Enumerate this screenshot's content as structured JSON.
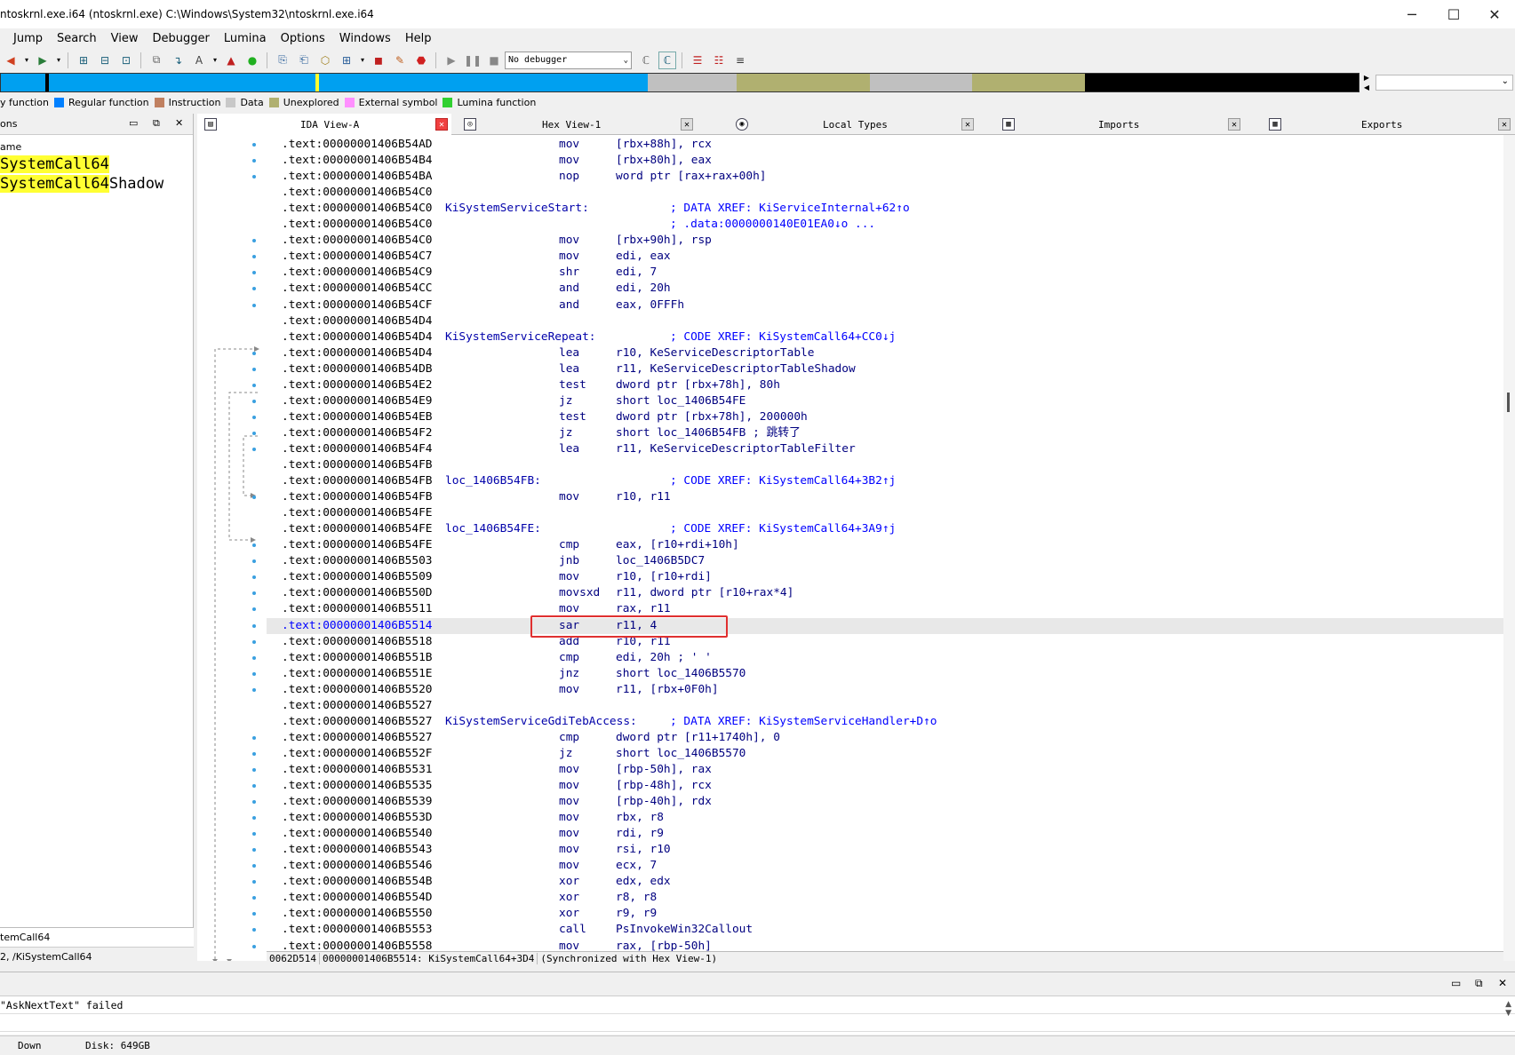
{
  "window": {
    "title": "ntoskrnl.exe.i64 (ntoskrnl.exe) C:\\Windows\\System32\\ntoskrnl.exe.i64",
    "minimize": "─",
    "maximize": "☐",
    "close": "✕"
  },
  "menu": [
    "Jump",
    "Search",
    "View",
    "Debugger",
    "Lumina",
    "Options",
    "Windows",
    "Help"
  ],
  "toolbar": {
    "debugger_select": "No debugger"
  },
  "navband_colors": {
    "regular_function": "#00a0f0",
    "instruction": "#c08060",
    "data": "#c0c0c0",
    "unexplored": "#b0b070",
    "external_symbol": "#ff90ff",
    "lumina_function": "#30d030",
    "library": "#000000"
  },
  "legend": [
    {
      "label": "y function",
      "color": ""
    },
    {
      "label": "Regular function",
      "color": "#0080ff"
    },
    {
      "label": "Instruction",
      "color": "#c08060"
    },
    {
      "label": "Data",
      "color": "#c8c8c8"
    },
    {
      "label": "Unexplored",
      "color": "#b0b070"
    },
    {
      "label": "External symbol",
      "color": "#ff90ff"
    },
    {
      "label": "Lumina function",
      "color": "#30d030"
    }
  ],
  "left_panel": {
    "header": "ons",
    "column_header": "ame",
    "functions": [
      {
        "hl": "SystemCall64",
        "rest": ""
      },
      {
        "hl": "SystemCall64",
        "rest": "Shadow"
      }
    ],
    "selected_footer": "temCall64",
    "path_footer": "2, /KiSystemCall64"
  },
  "tabs": [
    {
      "label": "IDA View-A",
      "icon": "▤"
    },
    {
      "label": "Hex View-1",
      "icon": "◎"
    },
    {
      "label": "Local Types",
      "icon": "◉"
    },
    {
      "label": "Imports",
      "icon": "▦"
    },
    {
      "label": "Exports",
      "icon": "▦"
    }
  ],
  "listing": [
    {
      "addr": ".text:00000001406B54AD",
      "mn": "mov",
      "op": "[rbx+88h], rcx"
    },
    {
      "addr": ".text:00000001406B54B4",
      "mn": "mov",
      "op": "[rbx+80h], eax"
    },
    {
      "addr": ".text:00000001406B54BA",
      "mn": "nop",
      "op": "word ptr [rax+rax+00h]"
    },
    {
      "addr": ".text:00000001406B54C0"
    },
    {
      "addr": ".text:00000001406B54C0",
      "lbl": "KiSystemServiceStart:",
      "xref": "; DATA XREF: KiServiceInternal+62↑o"
    },
    {
      "addr": ".text:00000001406B54C0",
      "xref": "; .data:0000000140E01EA0↓o ..."
    },
    {
      "addr": ".text:00000001406B54C0",
      "mn": "mov",
      "op": "[rbx+90h], rsp"
    },
    {
      "addr": ".text:00000001406B54C7",
      "mn": "mov",
      "op": "edi, eax"
    },
    {
      "addr": ".text:00000001406B54C9",
      "mn": "shr",
      "op": "edi, 7"
    },
    {
      "addr": ".text:00000001406B54CC",
      "mn": "and",
      "op": "edi, 20h"
    },
    {
      "addr": ".text:00000001406B54CF",
      "mn": "and",
      "op": "eax, 0FFFh"
    },
    {
      "addr": ".text:00000001406B54D4"
    },
    {
      "addr": ".text:00000001406B54D4",
      "lbl": "KiSystemServiceRepeat:",
      "xref": "; CODE XREF: KiSystemCall64+CC0↓j"
    },
    {
      "addr": ".text:00000001406B54D4",
      "mn": "lea",
      "op": "r10, KeServiceDescriptorTable"
    },
    {
      "addr": ".text:00000001406B54DB",
      "mn": "lea",
      "op": "r11, KeServiceDescriptorTableShadow"
    },
    {
      "addr": ".text:00000001406B54E2",
      "mn": "test",
      "op": "dword ptr [rbx+78h], 80h"
    },
    {
      "addr": ".text:00000001406B54E9",
      "mn": "jz",
      "op": "short loc_1406B54FE"
    },
    {
      "addr": ".text:00000001406B54EB",
      "mn": "test",
      "op": "dword ptr [rbx+78h], 200000h"
    },
    {
      "addr": ".text:00000001406B54F2",
      "mn": "jz",
      "op": "short loc_1406B54FB ; 跳转了"
    },
    {
      "addr": ".text:00000001406B54F4",
      "mn": "lea",
      "op": "r11, KeServiceDescriptorTableFilter"
    },
    {
      "addr": ".text:00000001406B54FB"
    },
    {
      "addr": ".text:00000001406B54FB",
      "lbl": "loc_1406B54FB:",
      "xref": "; CODE XREF: KiSystemCall64+3B2↑j"
    },
    {
      "addr": ".text:00000001406B54FB",
      "mn": "mov",
      "op": "r10, r11"
    },
    {
      "addr": ".text:00000001406B54FE"
    },
    {
      "addr": ".text:00000001406B54FE",
      "lbl": "loc_1406B54FE:",
      "xref": "; CODE XREF: KiSystemCall64+3A9↑j"
    },
    {
      "addr": ".text:00000001406B54FE",
      "mn": "cmp",
      "op": "eax, [r10+rdi+10h]"
    },
    {
      "addr": ".text:00000001406B5503",
      "mn": "jnb",
      "op": "loc_1406B5DC7"
    },
    {
      "addr": ".text:00000001406B5509",
      "mn": "mov",
      "op": "r10, [r10+rdi]"
    },
    {
      "addr": ".text:00000001406B550D",
      "mn": "movsxd",
      "op": "r11, dword ptr [r10+rax*4]"
    },
    {
      "addr": ".text:00000001406B5511",
      "mn": "mov",
      "op": "rax, r11"
    },
    {
      "addr": ".text:00000001406B5514",
      "mn": "sar",
      "op": "r11, 4",
      "cur": true
    },
    {
      "addr": ".text:00000001406B5518",
      "mn": "add",
      "op": "r10, r11"
    },
    {
      "addr": ".text:00000001406B551B",
      "mn": "cmp",
      "op": "edi, 20h ; ' '"
    },
    {
      "addr": ".text:00000001406B551E",
      "mn": "jnz",
      "op": "short loc_1406B5570"
    },
    {
      "addr": ".text:00000001406B5520",
      "mn": "mov",
      "op": "r11, [rbx+0F0h]"
    },
    {
      "addr": ".text:00000001406B5527"
    },
    {
      "addr": ".text:00000001406B5527",
      "lbl": "KiSystemServiceGdiTebAccess:",
      "xref": "; DATA XREF: KiSystemServiceHandler+D↑o"
    },
    {
      "addr": ".text:00000001406B5527",
      "mn": "cmp",
      "op": "dword ptr [r11+1740h], 0"
    },
    {
      "addr": ".text:00000001406B552F",
      "mn": "jz",
      "op": "short loc_1406B5570"
    },
    {
      "addr": ".text:00000001406B5531",
      "mn": "mov",
      "op": "[rbp-50h], rax"
    },
    {
      "addr": ".text:00000001406B5535",
      "mn": "mov",
      "op": "[rbp-48h], rcx"
    },
    {
      "addr": ".text:00000001406B5539",
      "mn": "mov",
      "op": "[rbp-40h], rdx"
    },
    {
      "addr": ".text:00000001406B553D",
      "mn": "mov",
      "op": "rbx, r8"
    },
    {
      "addr": ".text:00000001406B5540",
      "mn": "mov",
      "op": "rdi, r9"
    },
    {
      "addr": ".text:00000001406B5543",
      "mn": "mov",
      "op": "rsi, r10"
    },
    {
      "addr": ".text:00000001406B5546",
      "mn": "mov",
      "op": "ecx, 7"
    },
    {
      "addr": ".text:00000001406B554B",
      "mn": "xor",
      "op": "edx, edx"
    },
    {
      "addr": ".text:00000001406B554D",
      "mn": "xor",
      "op": "r8, r8"
    },
    {
      "addr": ".text:00000001406B5550",
      "mn": "xor",
      "op": "r9, r9"
    },
    {
      "addr": ".text:00000001406B5553",
      "mn": "call",
      "op": "PsInvokeWin32Callout"
    },
    {
      "addr": ".text:00000001406B5558",
      "mn": "mov",
      "op": "rax, [rbp-50h]"
    }
  ],
  "status_line": {
    "offset": "0062D514",
    "location": "00000001406B5514: KiSystemCall64+3D4",
    "sync": "(Synchronized with Hex View-1)"
  },
  "output": {
    "lines": [
      "\"AskNextText\" failed",
      ""
    ]
  },
  "bottom": {
    "state": "Down",
    "disk": "Disk: 649GB"
  }
}
